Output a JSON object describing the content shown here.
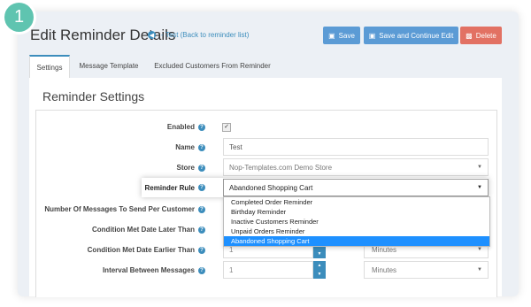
{
  "step_number": "1",
  "header": {
    "title": "Edit Reminder Details",
    "back_link": "- Test (Back to reminder list)",
    "buttons": {
      "save": "Save",
      "save_continue": "Save and Continue Edit",
      "delete": "Delete"
    }
  },
  "tabs": [
    "Settings",
    "Message Template",
    "Excluded Customers From Reminder"
  ],
  "section_title": "Reminder Settings",
  "fields": {
    "enabled_label": "Enabled",
    "enabled_checked": true,
    "name_label": "Name",
    "name_value": "Test",
    "store_label": "Store",
    "store_value": "Nop-Templates.com Demo Store",
    "rule_label": "Reminder Rule",
    "rule_value": "Abandoned Shopping Cart",
    "messages_label": "Number Of Messages To Send Per Customer",
    "later_label": "Condition Met Date Later Than",
    "earlier_label": "Condition Met Date Earlier Than",
    "earlier_value": "1",
    "earlier_unit": "Minutes",
    "interval_label": "Interval Between Messages",
    "interval_value": "1",
    "interval_unit": "Minutes"
  },
  "rule_options": [
    "Completed Order Reminder",
    "Birthday Reminder",
    "Inactive Customers Reminder",
    "Unpaid Orders Reminder",
    "Abandoned Shopping Cart"
  ],
  "colors": {
    "primary": "#5b9bd5",
    "danger": "#e27163",
    "step_badge": "#5fc4b0",
    "selected_option": "#1e90ff"
  }
}
